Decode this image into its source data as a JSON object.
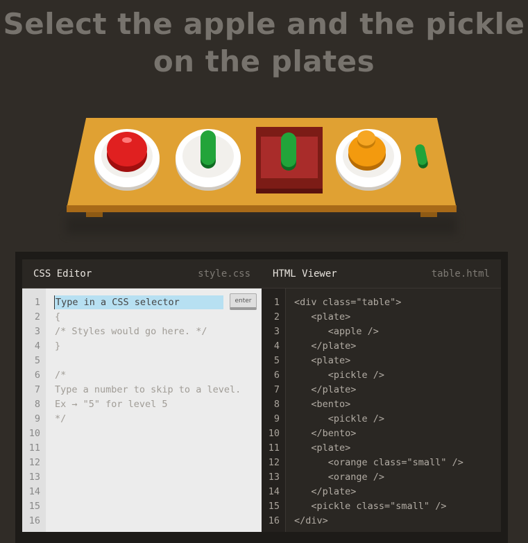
{
  "instruction": "Select the apple and the pickle on the plates",
  "scene": {
    "items": [
      "plate-apple",
      "plate-pickle",
      "bento-pickle",
      "plate-orange-small-orange",
      "pickle-small"
    ]
  },
  "css_editor": {
    "title": "CSS Editor",
    "file": "style.css",
    "input_placeholder": "Type in a CSS selector",
    "enter_label": "enter",
    "line_numbers": [
      "1",
      "2",
      "3",
      "4",
      "5",
      "6",
      "7",
      "8",
      "9",
      "10",
      "11",
      "12",
      "13",
      "14",
      "15",
      "16"
    ],
    "code_lines": [
      "",
      "{",
      "/* Styles would go here. */",
      "}",
      "",
      "/*",
      "Type a number to skip to a level.",
      "Ex → \"5\" for level 5",
      "*/"
    ]
  },
  "html_viewer": {
    "title": "HTML Viewer",
    "file": "table.html",
    "line_numbers": [
      "1",
      "2",
      "3",
      "4",
      "5",
      "6",
      "7",
      "8",
      "9",
      "10",
      "11",
      "12",
      "13",
      "14",
      "15",
      "16"
    ],
    "code_lines": [
      "<div class=\"table\">",
      "   <plate>",
      "      <apple />",
      "   </plate>",
      "   <plate>",
      "      <pickle />",
      "   </plate>",
      "   <bento>",
      "      <pickle />",
      "   </bento>",
      "   <plate>",
      "      <orange class=\"small\" />",
      "      <orange />",
      "   </plate>",
      "   <pickle class=\"small\" />",
      "</div>"
    ]
  }
}
